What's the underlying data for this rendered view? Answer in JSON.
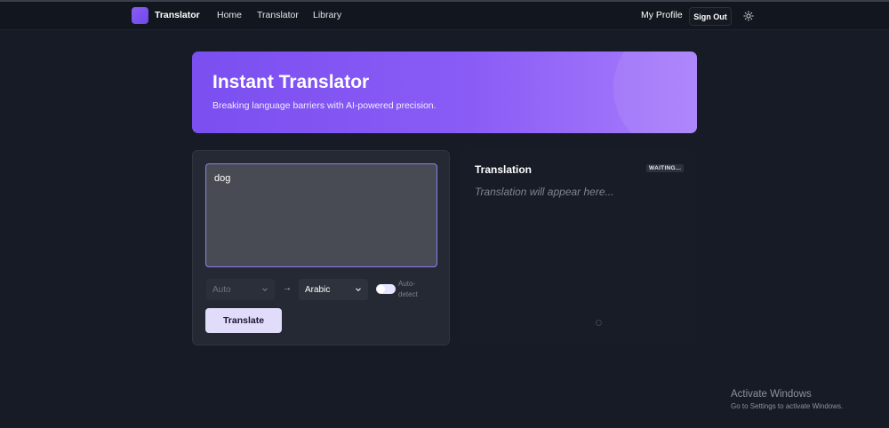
{
  "navbar": {
    "brand": "Translator",
    "links": [
      "Home",
      "Translator",
      "Library"
    ],
    "profile": "My Profile",
    "sign_out": "Sign Out",
    "theme_icon": "sun-icon"
  },
  "hero": {
    "title": "Instant Translator",
    "subtitle": "Breaking language barriers with AI-powered precision."
  },
  "input": {
    "value": "dog",
    "source_language": "Auto",
    "target_language": "Arabic",
    "arrow": "→",
    "auto_detect_label": "Auto-detect",
    "auto_detect_enabled": true,
    "translate_button": "Translate"
  },
  "output": {
    "title": "Translation",
    "status": "WAITING...",
    "placeholder": "Translation will appear here..."
  },
  "watermark": {
    "title": "Activate Windows",
    "subtitle": "Go to Settings to activate Windows."
  },
  "colors": {
    "background": "#161b26",
    "accent": "#8b5cf6",
    "hero_gradient_start": "#7b4ff0",
    "hero_gradient_end": "#a87dfb"
  }
}
